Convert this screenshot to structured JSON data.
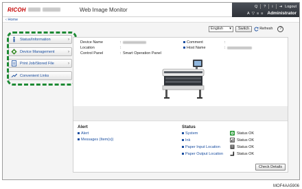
{
  "header": {
    "brand": "RICOH",
    "title": "Web Image Monitor",
    "util_row1": [
      "Q",
      "?",
      "i",
      "Logout"
    ],
    "util_row2_icons": [
      "A",
      "▽",
      "≡",
      "≡"
    ],
    "admin": "Administrator"
  },
  "breadcrumb": {
    "home": "Home"
  },
  "sidebar": {
    "items": [
      {
        "label": "Status/Information",
        "icon": "info-icon",
        "arrow": "›"
      },
      {
        "label": "Device Management",
        "icon": "device-management-icon",
        "arrow": "›"
      },
      {
        "label": "Print Job/Stored File",
        "icon": "document-icon",
        "arrow": "›"
      },
      {
        "label": "Convenient Links",
        "icon": "link-icon",
        "arrow": ""
      }
    ]
  },
  "toolbar": {
    "language": "English",
    "language_arrow": "▾",
    "switch_label": "Switch",
    "refresh_label": "Refresh",
    "help": "?"
  },
  "device_info": {
    "device_name_label": "Device Name",
    "location_label": "Location",
    "control_panel_label": "Control Panel",
    "colon": ":",
    "control_panel_value": "Smart Operation Panel",
    "comment_label": "Comment",
    "host_name_label": "Host Name"
  },
  "alert": {
    "title": "Alert",
    "items": [
      "Alert",
      "Messages (Item(s))"
    ]
  },
  "status": {
    "title": "Status",
    "items": [
      {
        "label": "System",
        "value": "Status OK",
        "icon": "system-ok-icon"
      },
      {
        "label": "Ink",
        "value": "Status OK",
        "icon": "ink-icon"
      },
      {
        "label": "Paper Input Location",
        "value": "Status OK",
        "icon": "paper-input-icon"
      },
      {
        "label": "Paper Output Location",
        "value": "Status OK",
        "icon": "paper-output-icon"
      }
    ]
  },
  "check_details": "Check Details",
  "caption": "MOF4AA5906",
  "colors": {
    "accent_green": "#1d8a34",
    "link_blue": "#1a4ea0",
    "brand_red": "#c40000"
  }
}
